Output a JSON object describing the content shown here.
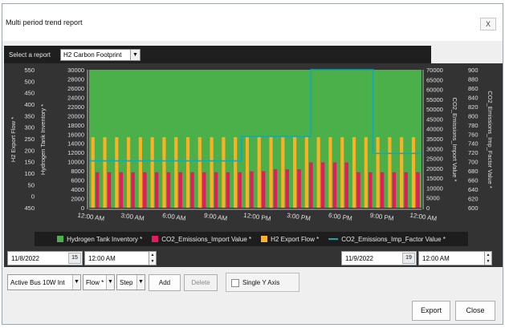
{
  "window": {
    "title": "Multi period trend report",
    "close_label": "X"
  },
  "report_select": {
    "label": "Select a report",
    "value": "H2 Carbon Footprint",
    "arrow": "▼"
  },
  "range": {
    "start_date": "11/8/2022",
    "start_day": "15",
    "start_time": "12:00 AM",
    "end_date": "11/9/2022",
    "end_day": "19",
    "end_time": "12:00 AM"
  },
  "controls": {
    "bus_value": "Active Bus 10W Int",
    "flow_value": "Flow *",
    "step_value": "Step",
    "add_label": "Add",
    "delete_label": "Delete",
    "single_axis_label": "Single Y Axis"
  },
  "footer": {
    "export_label": "Export",
    "close_label": "Close"
  },
  "colors": {
    "green": "#4cb04a",
    "magenta": "#e8195f",
    "orange": "#ffb020",
    "teal": "#13a8b4",
    "plot_bg": "#4b4b4b"
  },
  "icons": {
    "close": "close-icon",
    "dropdown": "chevron-down-icon",
    "calendar": "calendar-icon",
    "spin": "spin-updown-icon"
  },
  "chart_data": {
    "type": "bar",
    "x_tick_labels": [
      "12:00 AM",
      "3:00 AM",
      "6:00 AM",
      "9:00 AM",
      "12:00 PM",
      "3:00 PM",
      "6:00 PM",
      "9:00 PM",
      "12:00 AM"
    ],
    "axes": {
      "h2_export_flow": {
        "label": "H2 Export Flow *",
        "ticks": [
          450,
          400,
          350,
          300,
          250,
          200,
          150,
          100,
          50,
          0
        ],
        "ylim": [
          0,
          450
        ],
        "tick_label_texts": [
          "550",
          "500",
          "450",
          "400",
          "350",
          "300",
          "250",
          "200",
          "150",
          "100",
          "50",
          "0",
          "450"
        ]
      },
      "hydrogen_tank_inventory": {
        "label": "Hydrogen Tank Inventory *",
        "ticks": [
          30000,
          28000,
          26000,
          24000,
          22000,
          20000,
          18000,
          16000,
          14000,
          12000,
          10000,
          8000,
          6000,
          4000,
          2000,
          0
        ],
        "ylim": [
          0,
          30000
        ]
      },
      "co2_import": {
        "label": "CO2_Emissions_Import Value *",
        "ticks": [
          70000,
          65000,
          60000,
          55000,
          50000,
          45000,
          40000,
          35000,
          30000,
          25000,
          20000,
          15000,
          10000,
          5000,
          0
        ],
        "ylim": [
          0,
          70000
        ]
      },
      "co2_factor": {
        "label": "CO2_Emissions_Imp_Factor Value *",
        "ticks": [
          900,
          880,
          860,
          840,
          820,
          800,
          780,
          760,
          740,
          720,
          700,
          680,
          660,
          640,
          620,
          600
        ],
        "ylim": [
          600,
          900
        ]
      }
    },
    "left_outer_tick_labels": [
      "550",
      "500",
      "450",
      "400",
      "350",
      "300",
      "250",
      "200",
      "150",
      "100",
      "50",
      "0",
      "450"
    ],
    "left_inner_tick_labels": [
      "30000",
      "28000",
      "26000",
      "24000",
      "22000",
      "20000",
      "18000",
      "16000",
      "14000",
      "12000",
      "10000",
      "8000",
      "6000",
      "4000",
      "2000",
      "0"
    ],
    "right_inner_tick_labels": [
      "70000",
      "65000",
      "60000",
      "55000",
      "50000",
      "45000",
      "40000",
      "35000",
      "30000",
      "25000",
      "20000",
      "15000",
      "10000",
      "5000",
      "0"
    ],
    "right_outer_tick_labels": [
      "900",
      "880",
      "860",
      "840",
      "820",
      "800",
      "780",
      "760",
      "740",
      "720",
      "700",
      "680",
      "660",
      "640",
      "620",
      "600"
    ],
    "series": [
      {
        "name": "Hydrogen Tank Inventory *",
        "type": "area",
        "axis": "hydrogen_tank_inventory",
        "values": [
          30000,
          30000,
          30000,
          30000,
          30000,
          30000,
          30000,
          30000,
          30000,
          30000,
          30000,
          30000,
          30000,
          30000,
          30000,
          30000,
          30000,
          30000,
          30000,
          30000,
          30000,
          30000,
          30000,
          30000
        ]
      },
      {
        "name": "CO2_Emissions_Import Value *",
        "type": "bar",
        "axis": "co2_import",
        "values": [
          18000,
          18000,
          18000,
          18000,
          18000,
          18000,
          18000,
          18000,
          18000,
          18000,
          18000,
          18000,
          18000,
          18500,
          18500,
          19500,
          19500,
          19500,
          23000,
          23000,
          23000,
          23000,
          18000,
          18000,
          18000,
          18000,
          18000,
          18000
        ]
      },
      {
        "name": "H2 Export Flow *",
        "type": "bar",
        "axis": "h2_export_flow",
        "values": [
          230,
          230,
          230,
          230,
          230,
          230,
          230,
          230,
          230,
          230,
          230,
          230,
          230,
          230,
          230,
          230,
          230,
          230,
          230,
          230,
          230,
          230,
          230,
          230,
          230,
          230,
          230,
          230
        ]
      },
      {
        "name": "CO2_Emissions_Imp_Factor Value *",
        "type": "step-line",
        "axis": "co2_factor",
        "x": [
          0,
          11,
          11,
          16,
          16,
          20.5,
          20.5,
          24
        ],
        "values": [
          702,
          702,
          755,
          755,
          900,
          900,
          718,
          718
        ]
      }
    ],
    "xlim": [
      0,
      24
    ],
    "grid": false,
    "legend": "bottom"
  }
}
